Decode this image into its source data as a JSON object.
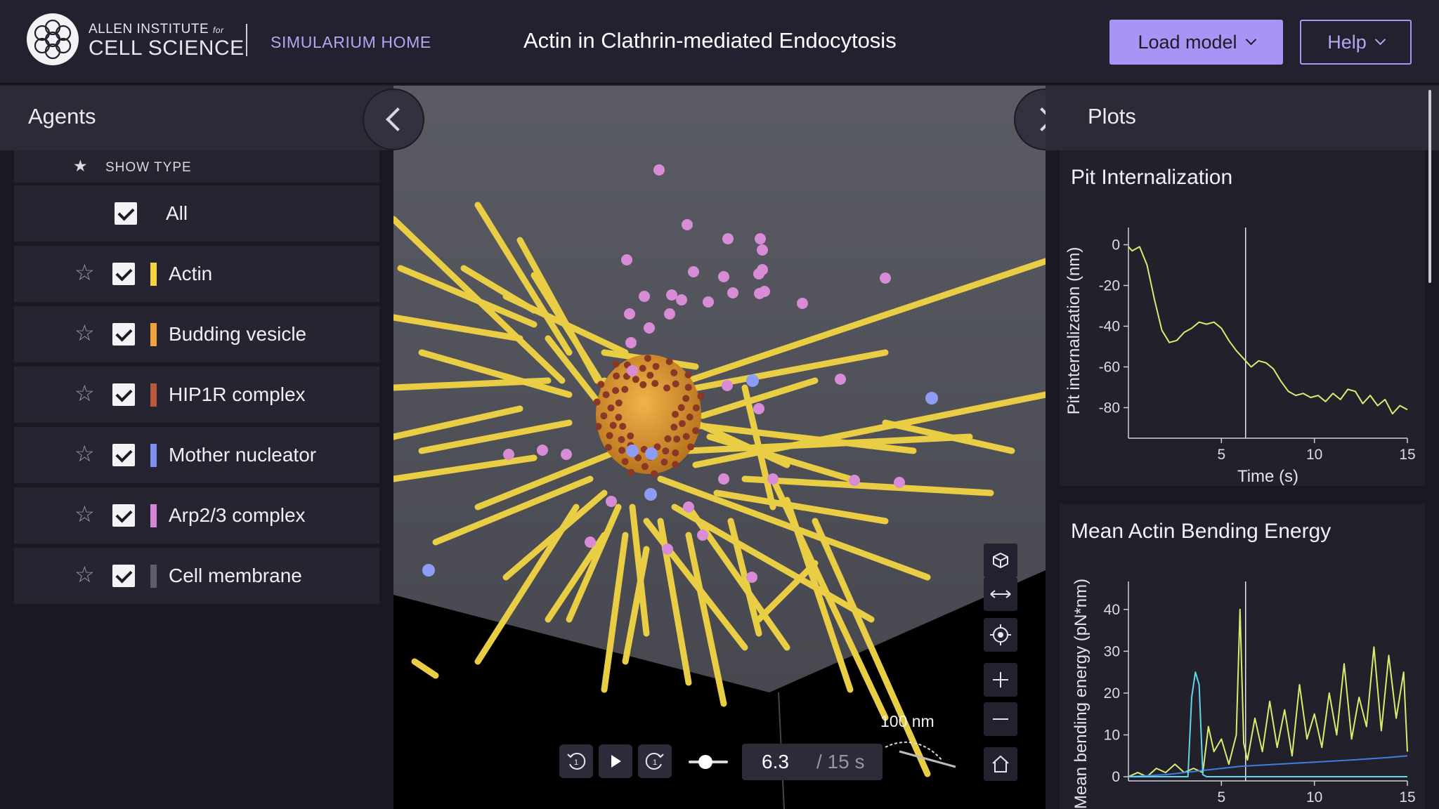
{
  "header": {
    "logo_line1": "ALLEN INSTITUTE",
    "logo_for": "for",
    "logo_line2": "CELL SCIENCE",
    "home_link": "SIMULARIUM HOME",
    "title": "Actin in Clathrin-mediated Endocytosis",
    "load_button": "Load model",
    "help_button": "Help"
  },
  "agents_panel": {
    "title": "Agents",
    "show_type_label": "SHOW TYPE",
    "all_label": "All",
    "items": [
      {
        "label": "Actin",
        "color": "#f5d33f",
        "checked": true
      },
      {
        "label": "Budding vesicle",
        "color": "#f0a33c",
        "checked": true
      },
      {
        "label": "HIP1R complex",
        "color": "#b75a3c",
        "checked": true
      },
      {
        "label": "Mother nucleator",
        "color": "#7f8ff0",
        "checked": true
      },
      {
        "label": "Arp2/3 complex",
        "color": "#d487d6",
        "checked": true
      },
      {
        "label": "Cell membrane",
        "color": "#5d5c6a",
        "checked": true
      }
    ]
  },
  "viewer": {
    "scale_bar": "100 nm",
    "time_current": "6.3",
    "time_total": "/ 15 s",
    "icons": [
      "rotate-view-icon",
      "pan-icon",
      "focus-icon",
      "zoom-in-icon",
      "zoom-out-icon",
      "home-icon"
    ]
  },
  "plots_panel": {
    "title": "Plots",
    "plots": [
      {
        "title": "Pit Internalization",
        "xlabel": "Time (s)",
        "ylabel": "Pit internalization (nm)",
        "x_ticks": [
          "5",
          "10",
          "15"
        ],
        "y_ticks": [
          "0",
          "-20",
          "-40",
          "-60",
          "-80"
        ]
      },
      {
        "title": "Mean Actin Bending Energy",
        "xlabel": "",
        "ylabel": "Mean bending energy (pN*nm)",
        "x_ticks": [
          "5",
          "10",
          "15"
        ],
        "y_ticks": [
          "40",
          "30",
          "20",
          "10",
          "0"
        ]
      }
    ]
  },
  "chart_data": [
    {
      "type": "line",
      "title": "Pit Internalization",
      "xlabel": "Time (s)",
      "ylabel": "Pit internalization (nm)",
      "xlim": [
        0,
        15
      ],
      "ylim": [
        -95,
        5
      ],
      "current_time": 6.3,
      "series": [
        {
          "color": "#d8ec6e",
          "x": [
            0,
            0.2,
            0.4,
            0.6,
            1.0,
            1.4,
            1.8,
            2.2,
            2.6,
            3.0,
            3.4,
            3.8,
            4.2,
            4.6,
            5.0,
            5.4,
            5.8,
            6.2,
            6.6,
            7.0,
            7.4,
            7.8,
            8.2,
            8.6,
            9.0,
            9.4,
            9.8,
            10.2,
            10.6,
            11.0,
            11.4,
            11.8,
            12.2,
            12.6,
            13.0,
            13.4,
            13.8,
            14.2,
            14.6,
            15.0
          ],
          "values": [
            -1,
            -3,
            -2,
            -1,
            -10,
            -27,
            -42,
            -48,
            -47,
            -43,
            -41,
            -38,
            -39,
            -38,
            -41,
            -47,
            -52,
            -56,
            -60,
            -57,
            -58,
            -61,
            -67,
            -72,
            -74,
            -73,
            -75,
            -74,
            -77,
            -73,
            -76,
            -71,
            -72,
            -78,
            -74,
            -79,
            -76,
            -83,
            -79,
            -81
          ]
        }
      ]
    },
    {
      "type": "line",
      "title": "Mean Actin Bending Energy",
      "xlabel": "",
      "ylabel": "Mean bending energy (pN*nm)",
      "xlim": [
        0,
        15
      ],
      "ylim": [
        -1,
        45
      ],
      "current_time": 6.3,
      "series": [
        {
          "color": "#d8ec6e",
          "x": [
            0,
            0.5,
            1.0,
            1.5,
            2.0,
            2.5,
            3.0,
            3.5,
            4.0,
            4.3,
            4.6,
            5.0,
            5.4,
            5.8,
            6.0,
            6.2,
            6.4,
            6.8,
            7.2,
            7.6,
            8.0,
            8.4,
            8.8,
            9.2,
            9.6,
            10.0,
            10.4,
            10.8,
            11.2,
            11.6,
            12.0,
            12.4,
            12.8,
            13.2,
            13.6,
            14.0,
            14.4,
            14.8,
            15.0
          ],
          "values": [
            0,
            1,
            0,
            2,
            1,
            3,
            1,
            2,
            1,
            12,
            6,
            9,
            3,
            10,
            40,
            8,
            4,
            14,
            6,
            18,
            7,
            16,
            5,
            22,
            9,
            15,
            7,
            20,
            10,
            27,
            9,
            19,
            12,
            31,
            11,
            29,
            14,
            25,
            6
          ]
        },
        {
          "color": "#3f7de0",
          "x": [
            0,
            2,
            4,
            6,
            8,
            10,
            12,
            14,
            15
          ],
          "values": [
            0,
            0.5,
            1.5,
            2.5,
            3,
            3.5,
            4,
            4.6,
            5
          ]
        },
        {
          "color": "#5fd6ea",
          "x": [
            0,
            3.2,
            3.4,
            3.6,
            3.8,
            4.0,
            4.2,
            5,
            10,
            15
          ],
          "values": [
            0,
            0,
            19,
            25,
            22,
            0.5,
            0,
            0,
            0,
            0
          ]
        }
      ]
    }
  ]
}
